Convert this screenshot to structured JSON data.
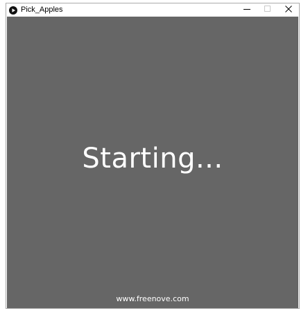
{
  "window": {
    "title": "Pick_Apples",
    "app_icon": "play-circle-icon",
    "controls": {
      "minimize_icon": "minimize-icon",
      "maximize_icon": "maximize-icon",
      "close_icon": "close-icon"
    }
  },
  "canvas": {
    "background_color": "#666666",
    "status_text": "Starting...",
    "footer_url": "www.freenove.com"
  }
}
